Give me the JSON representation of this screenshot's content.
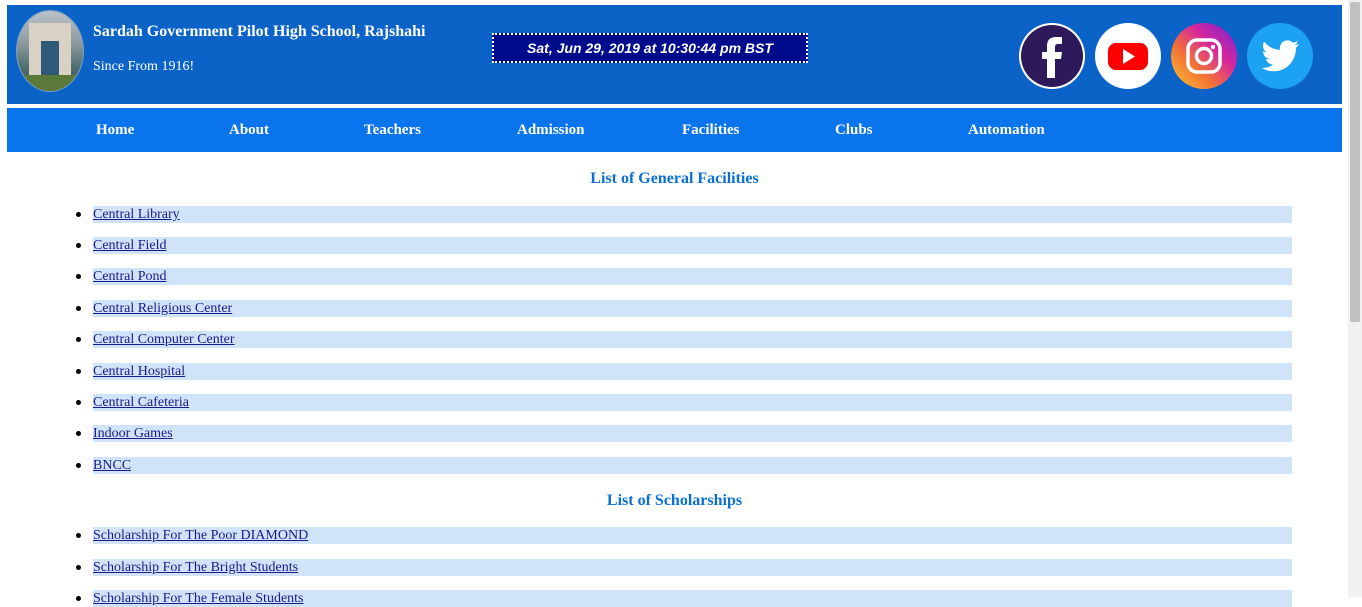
{
  "header": {
    "school_name": "Sardah Government Pilot High School, Rajshahi",
    "since": "Since From 1916!",
    "clock": "Sat, Jun 29, 2019 at 10:30:44 pm BST"
  },
  "social": [
    {
      "name": "facebook",
      "icon": "facebook-icon",
      "color": "#2e1a5a"
    },
    {
      "name": "youtube",
      "icon": "youtube-icon",
      "color": "#ff0000"
    },
    {
      "name": "instagram",
      "icon": "instagram-icon",
      "color": "#c13584"
    },
    {
      "name": "twitter",
      "icon": "twitter-icon",
      "color": "#1da1f2"
    }
  ],
  "nav": [
    "Home",
    "About",
    "Teachers",
    "Admission",
    "Facilities",
    "Clubs",
    "Automation"
  ],
  "general_facilities": {
    "title": "List of General Facilities",
    "items": [
      "Central Library",
      "Central Field",
      "Central Pond",
      "Central Religious Center",
      "Central Computer Center",
      "Central Hospital",
      "Central Cafeteria",
      "Indoor Games",
      "BNCC"
    ]
  },
  "scholarships": {
    "title": "List of Scholarships",
    "items": [
      "Scholarship For The Poor DIAMOND",
      "Scholarship For The Bright Students",
      "Scholarship For The Female Students"
    ]
  },
  "colors": {
    "header_bg": "#0b63c8",
    "nav_bg": "#0a74ec",
    "heading": "#0a6fd6",
    "row_highlight": "#cfe3f9",
    "clock_bg": "#000c8c"
  }
}
